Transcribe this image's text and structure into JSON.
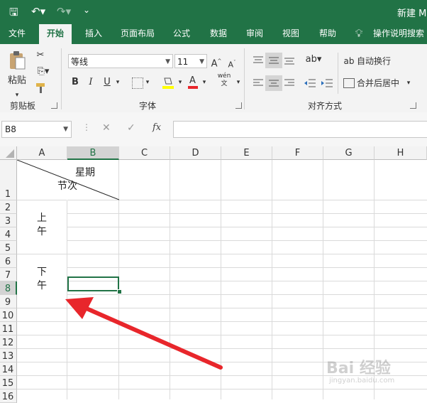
{
  "titlebar": {
    "title": "新建 M",
    "save": "🖫",
    "undo": "↶▾",
    "redo": "↷▾",
    "customize": "⌄"
  },
  "tabs": [
    "文件",
    "开始",
    "插入",
    "页面布局",
    "公式",
    "数据",
    "审阅",
    "视图",
    "帮助"
  ],
  "tell_me": "操作说明搜索",
  "clipboard": {
    "paste": "粘贴",
    "group": "剪贴板"
  },
  "font": {
    "name": "等线",
    "size": "11",
    "group": "字体",
    "bold": "B",
    "italic": "I",
    "underline": "U",
    "font_color": "A",
    "phonetic": "wén"
  },
  "alignment": {
    "wrap": "自动换行",
    "merge": "合并后居中",
    "group": "对齐方式"
  },
  "formula_bar": {
    "name_box": "B8",
    "value": "",
    "fx": "fx"
  },
  "columns": [
    "A",
    "B",
    "C",
    "D",
    "E",
    "F",
    "G",
    "H"
  ],
  "rows": [
    "1",
    "2",
    "3",
    "4",
    "5",
    "6",
    "7",
    "8",
    "9",
    "10",
    "11",
    "12",
    "13",
    "14",
    "15",
    "16"
  ],
  "cells": {
    "a1_top": "星期",
    "a1_bottom": "节次",
    "a3_line1": "上",
    "a3_line2": "午",
    "a7_line1": "下",
    "a7_line2": "午"
  },
  "watermark": "Bai 经验",
  "watermark_url": "jingyan.baidu.com",
  "colors": {
    "excel_green": "#217346",
    "arrow_red": "#e8262b"
  }
}
